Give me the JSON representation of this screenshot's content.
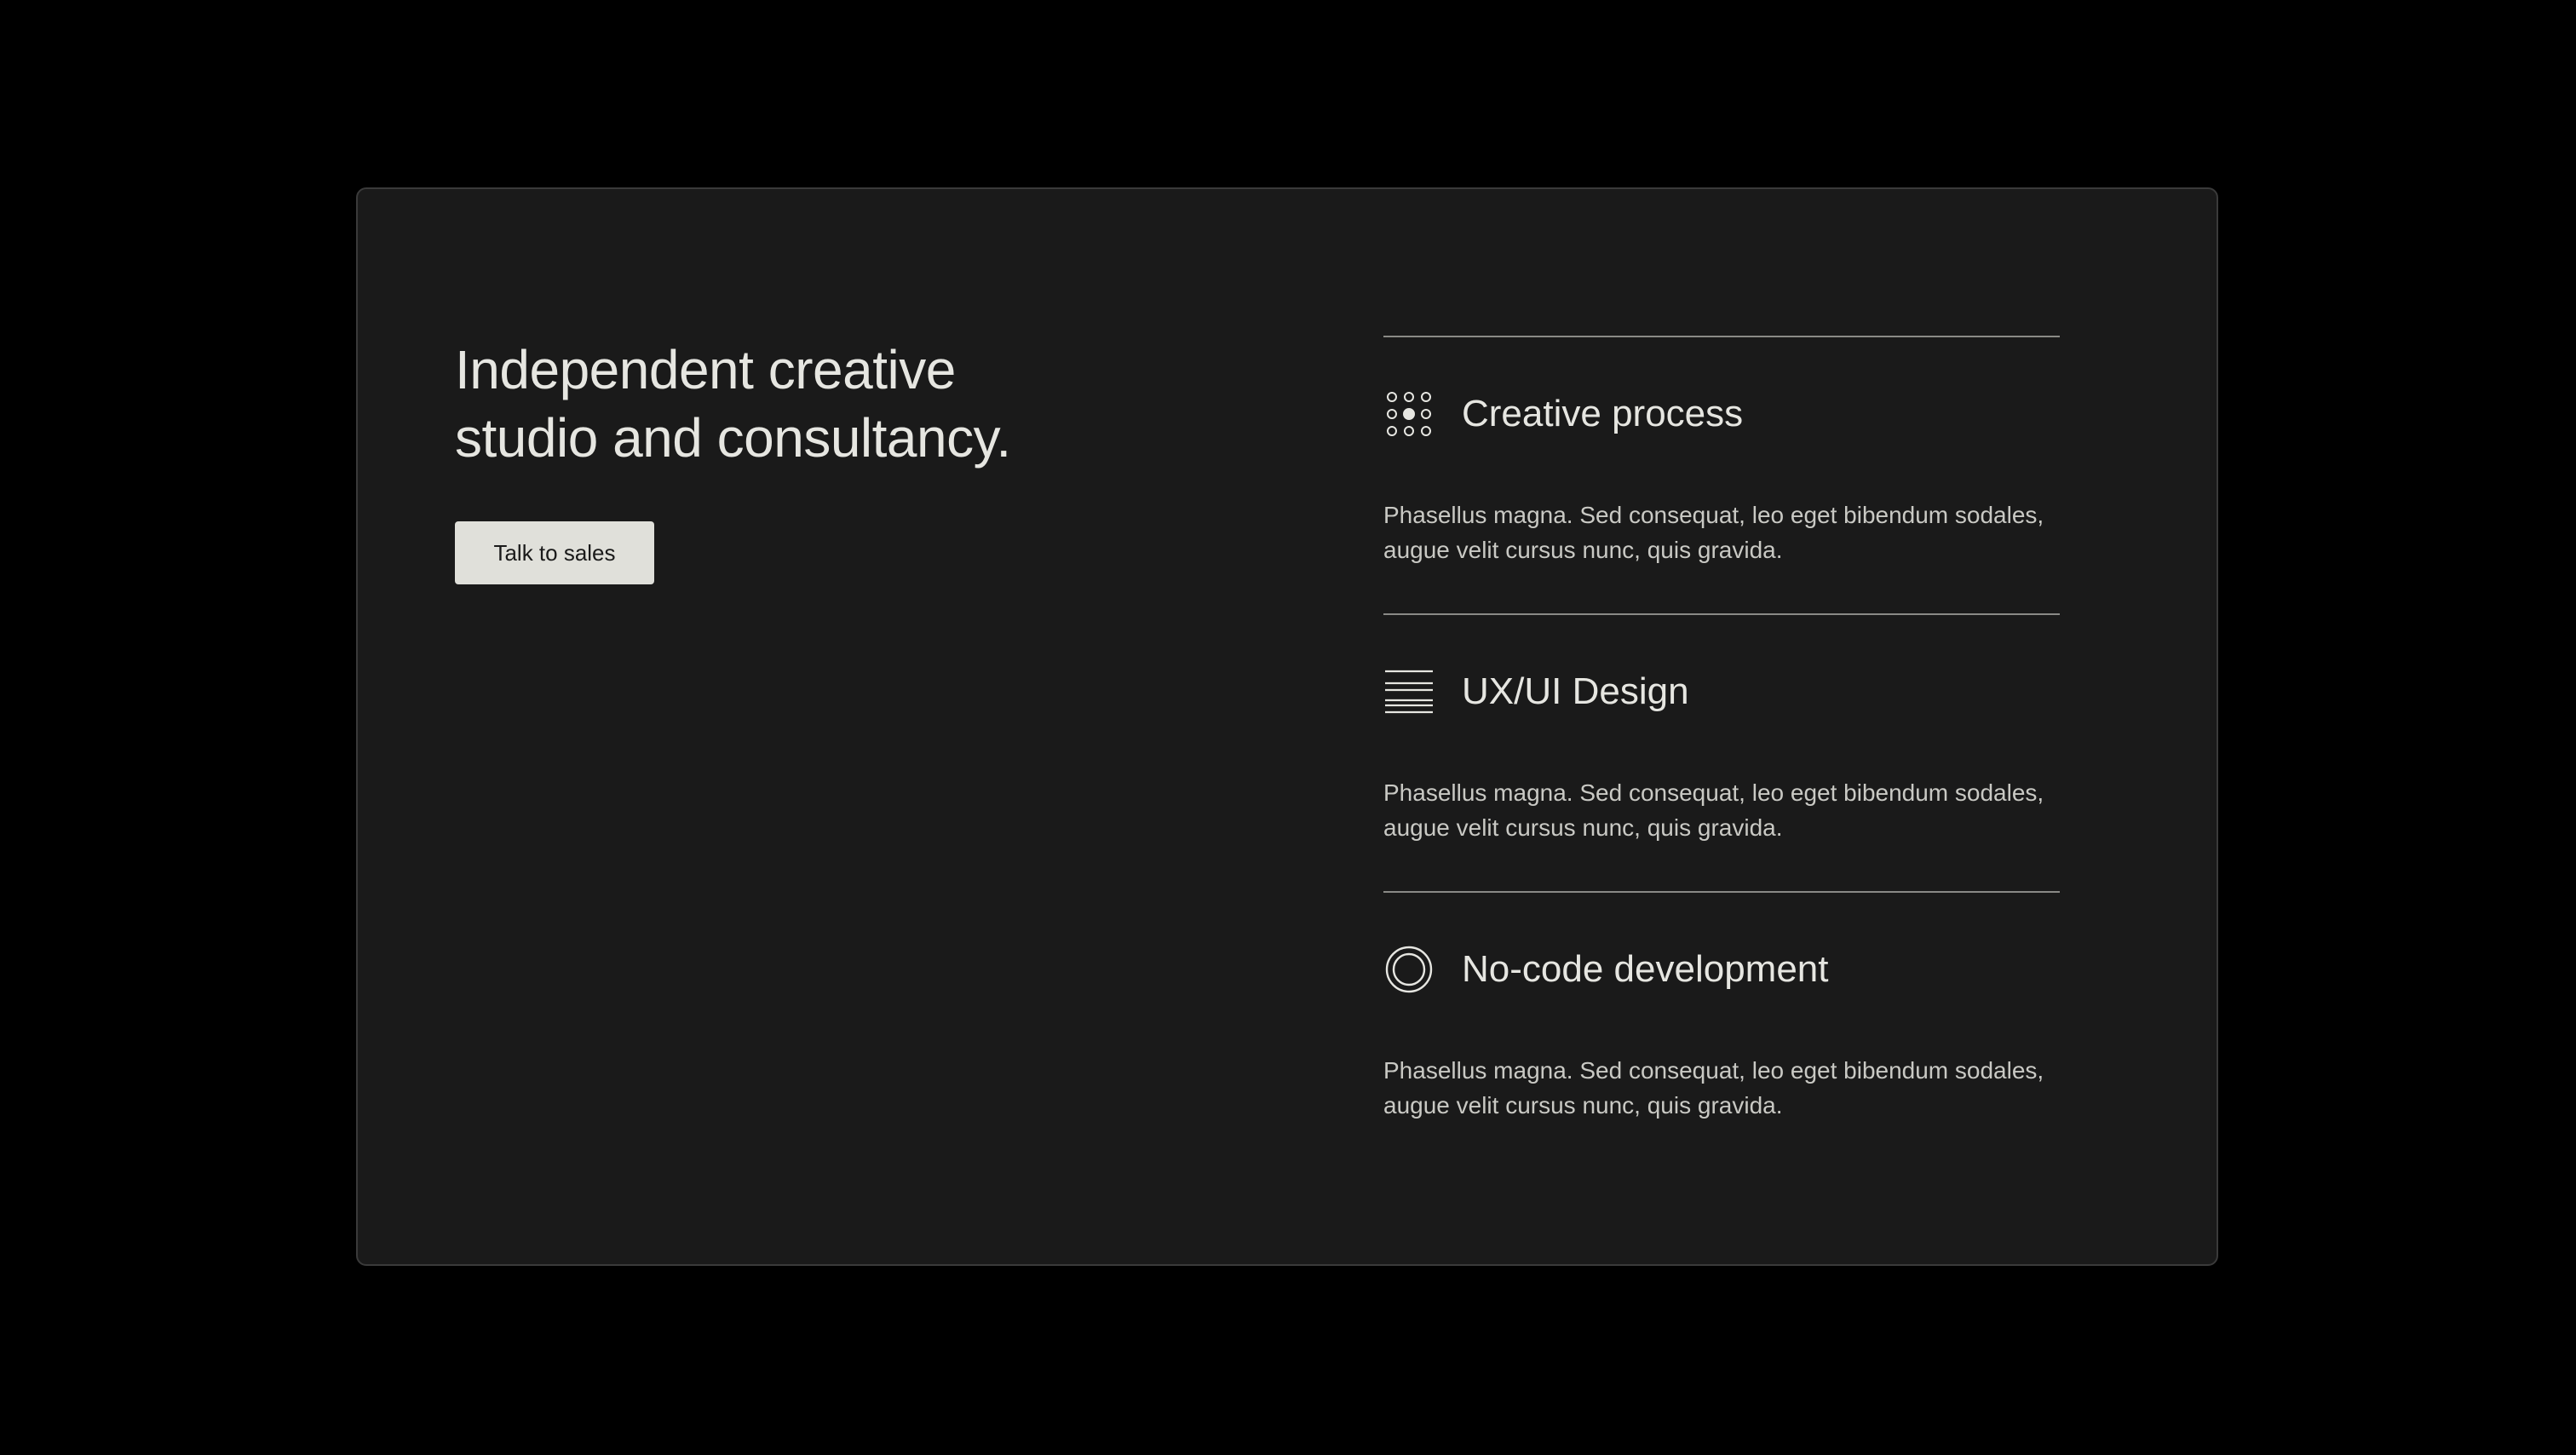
{
  "hero": {
    "headline_line1": "Independent creative",
    "headline_line2": "studio and consultancy.",
    "cta_label": "Talk to sales"
  },
  "features": [
    {
      "icon": "dot-grid-icon",
      "title": "Creative process",
      "text_line1": "Phasellus magna. Sed consequat, leo eget bibendum sodales,",
      "text_line2": "augue velit cursus nunc, quis gravida."
    },
    {
      "icon": "horizontal-lines-icon",
      "title": "UX/UI Design",
      "text_line1": "Phasellus magna. Sed consequat, leo eget bibendum sodales,",
      "text_line2": "augue velit cursus nunc, quis gravida."
    },
    {
      "icon": "concentric-circles-icon",
      "title": "No-code development",
      "text_line1": "Phasellus magna. Sed consequat, leo eget bibendum sodales,",
      "text_line2": "augue velit cursus nunc, quis gravida."
    }
  ],
  "colors": {
    "page_background": "#000000",
    "card_background": "#1a1a1a",
    "text_primary": "#e6e6e1",
    "text_secondary": "#c9c9c4",
    "button_background": "#e0e0da",
    "divider": "#8a8a86"
  }
}
